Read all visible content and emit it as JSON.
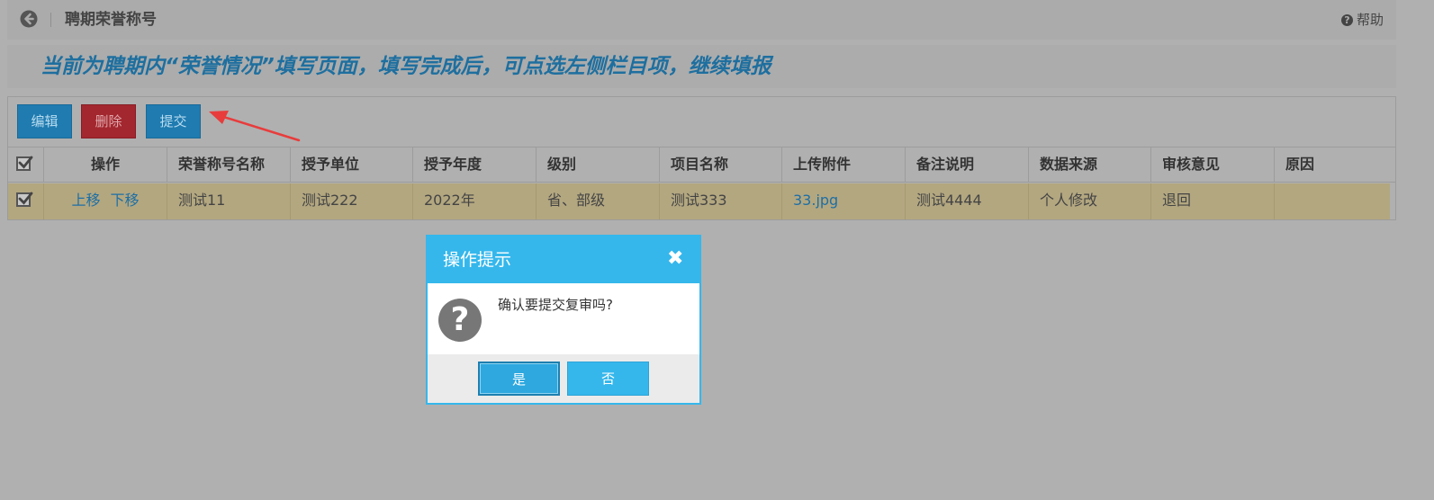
{
  "header": {
    "title": "聘期荣誉称号",
    "help_label": "帮助"
  },
  "notice": {
    "text": "当前为聘期内“荣誉情况”填写页面，填写完成后，可点选左侧栏目项，继续填报"
  },
  "toolbar": {
    "edit_label": "编辑",
    "delete_label": "删除",
    "submit_label": "提交"
  },
  "table": {
    "columns": [
      "操作",
      "荣誉称号名称",
      "授予单位",
      "授予年度",
      "级别",
      "项目名称",
      "上传附件",
      "备注说明",
      "数据来源",
      "审核意见",
      "原因"
    ],
    "rows": [
      {
        "actions": {
          "move_up": "上移",
          "move_down": "下移"
        },
        "honor_name": "测试11",
        "granting_unit": "测试222",
        "year": "2022年",
        "level": "省、部级",
        "project_name": "测试333",
        "attachment": "33.jpg",
        "remark": "测试4444",
        "source": "个人修改",
        "review": "退回",
        "reason": ""
      }
    ]
  },
  "dialog": {
    "title": "操作提示",
    "message": "确认要提交复审吗?",
    "yes_label": "是",
    "no_label": "否"
  },
  "colors": {
    "accent": "#35b7ec",
    "primary_button": "#1f7bb0",
    "danger_button": "#a3272f",
    "selected_row": "#b3a780",
    "notice_text": "#1e6f9f"
  }
}
